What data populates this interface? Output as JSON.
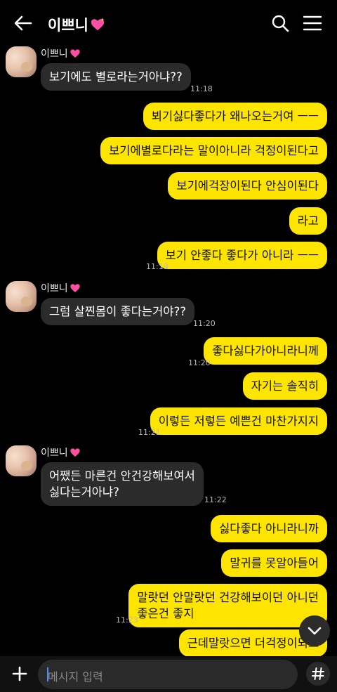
{
  "header": {
    "title": "이쁘니"
  },
  "messages": [
    {
      "sender": "이쁘니",
      "text": "보기에도 별로라는거아냐??",
      "time": "11:18"
    },
    {
      "text": "뵈기싫다좋다가 왜나오는거여 ㅡㅡ"
    },
    {
      "text": "보기에별로다라는 말이아니라 걱정이된다고"
    },
    {
      "text": "보기에걱장이된다 안심이된다"
    },
    {
      "text": "라고"
    },
    {
      "text": "보기 안좋다 좋다가 아니라 ㅡㅡ",
      "time": "11:19"
    },
    {
      "sender": "이쁘니",
      "text": "그럼 살찐몸이 좋다는거야??",
      "time": "11:20"
    },
    {
      "text": "좋다싫다가아니라니께",
      "time": "11:20"
    },
    {
      "text": "자기는 솔직히"
    },
    {
      "text": "이렇든 저렇든 예쁜건 마찬가지지",
      "time": "11:21"
    },
    {
      "sender": "이쁘니",
      "line1": "어쨌든 마른건 안건강해보여서",
      "line2": "싫다는거아냐?",
      "time": "11:22"
    },
    {
      "text": "싫다좋다 아니라니까"
    },
    {
      "text": "말귀를 못알아들어"
    },
    {
      "line1": "말랏던 안말랏던 건강해보이던 아니던",
      "line2": "좋은건 좋지",
      "time": "11:23"
    },
    {
      "line1": "근데말랏으면 더걱정이되고"
    }
  ],
  "input": {
    "placeholder": "메시지 입력"
  },
  "colors": {
    "sent_bubble": "#fee500",
    "received_bubble": "#2b2b2b",
    "background": "#000000",
    "heart": "#ff4fa3"
  },
  "icons": [
    "back-arrow-icon",
    "search-icon",
    "menu-icon",
    "sparkle-heart-icon",
    "chevron-down-icon",
    "plus-icon",
    "emoji-icon",
    "hash-icon"
  ]
}
